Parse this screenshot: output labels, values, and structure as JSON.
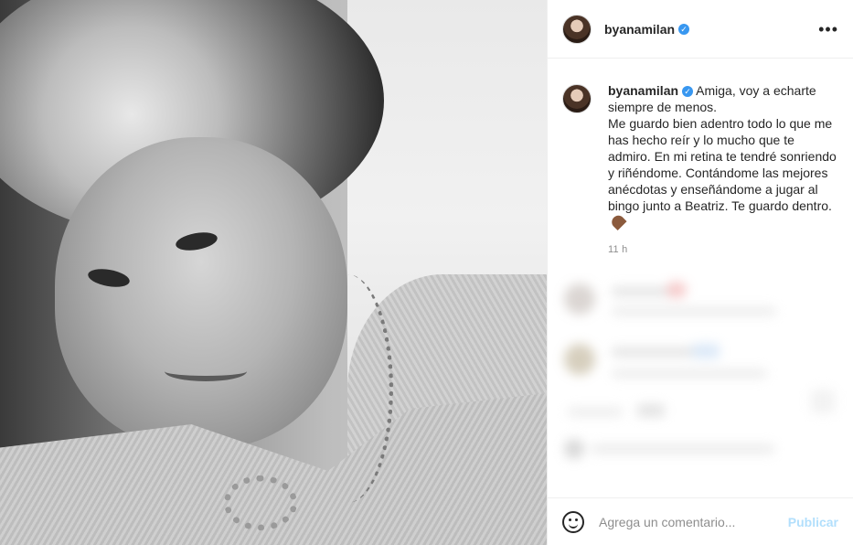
{
  "header": {
    "username": "byanamilan",
    "verified": true,
    "more_icon": "more-horizontal-icon"
  },
  "caption": {
    "username": "byanamilan",
    "text": "Amiga, voy a echarte siempre de menos.\nMe guardo bien adentro todo lo que me has hecho reír y lo mucho que te admiro. En mi retina te tendré sonriendo y riñéndome. Contándome las mejores anécdotas y enseñándome a jugar al bingo junto a Beatriz. Te guardo dentro.",
    "emoji": "brown-heart-icon",
    "timestamp": "11 h"
  },
  "add_comment": {
    "placeholder": "Agrega un comentario...",
    "publish_label": "Publicar",
    "emoji_icon": "smiley-icon"
  },
  "colors": {
    "verified": "#3897f0",
    "publish_disabled": "#b2dffc",
    "timestamp": "#8e8e8e"
  }
}
